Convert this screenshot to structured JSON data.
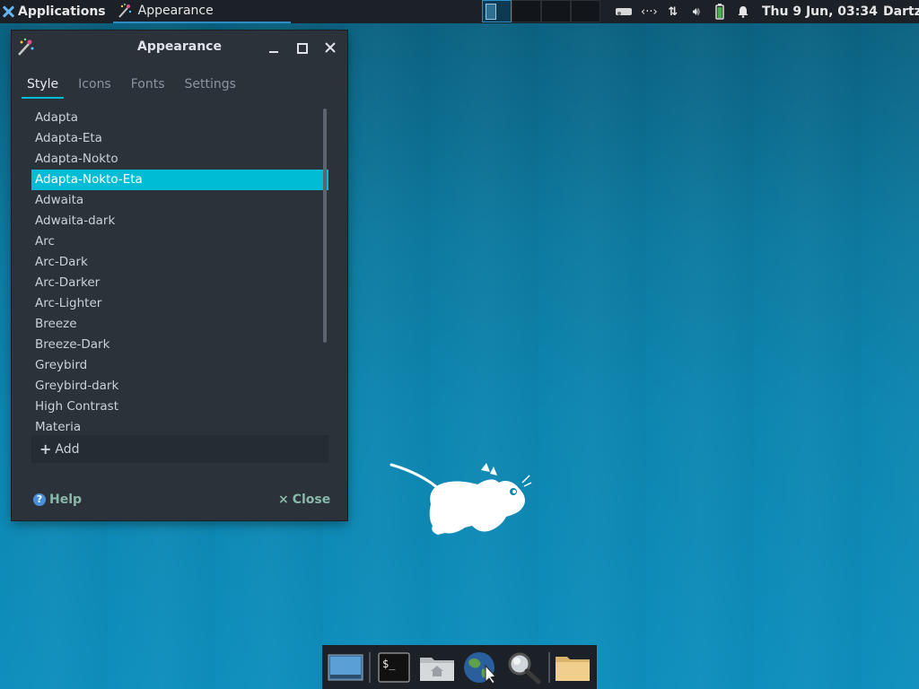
{
  "panel": {
    "applications_label": "Applications",
    "active_task": "Appearance",
    "clock": "Thu  9 Jun, 03:34",
    "user": "Dartz"
  },
  "window": {
    "title": "Appearance",
    "tabs": [
      {
        "label": "Style",
        "active": true
      },
      {
        "label": "Icons",
        "active": false
      },
      {
        "label": "Fonts",
        "active": false
      },
      {
        "label": "Settings",
        "active": false
      }
    ],
    "themes": [
      "Adapta",
      "Adapta-Eta",
      "Adapta-Nokto",
      "Adapta-Nokto-Eta",
      "Adwaita",
      "Adwaita-dark",
      "Arc",
      "Arc-Dark",
      "Arc-Darker",
      "Arc-Lighter",
      "Breeze",
      "Breeze-Dark",
      "Greybird",
      "Greybird-dark",
      "High Contrast",
      "Materia"
    ],
    "selected_theme": "Adapta-Nokto-Eta",
    "add_label": "Add",
    "help_label": "Help",
    "close_label": "Close"
  },
  "colors": {
    "accent": "#00bcd4",
    "panel_bg": "#1c2127",
    "window_bg": "#2b323a",
    "desktop_bg": "#0d86b0"
  },
  "dock": {
    "items": [
      "show-desktop-icon",
      "terminal-icon",
      "home-folder-icon",
      "web-browser-icon",
      "search-icon",
      "file-manager-icon"
    ]
  }
}
